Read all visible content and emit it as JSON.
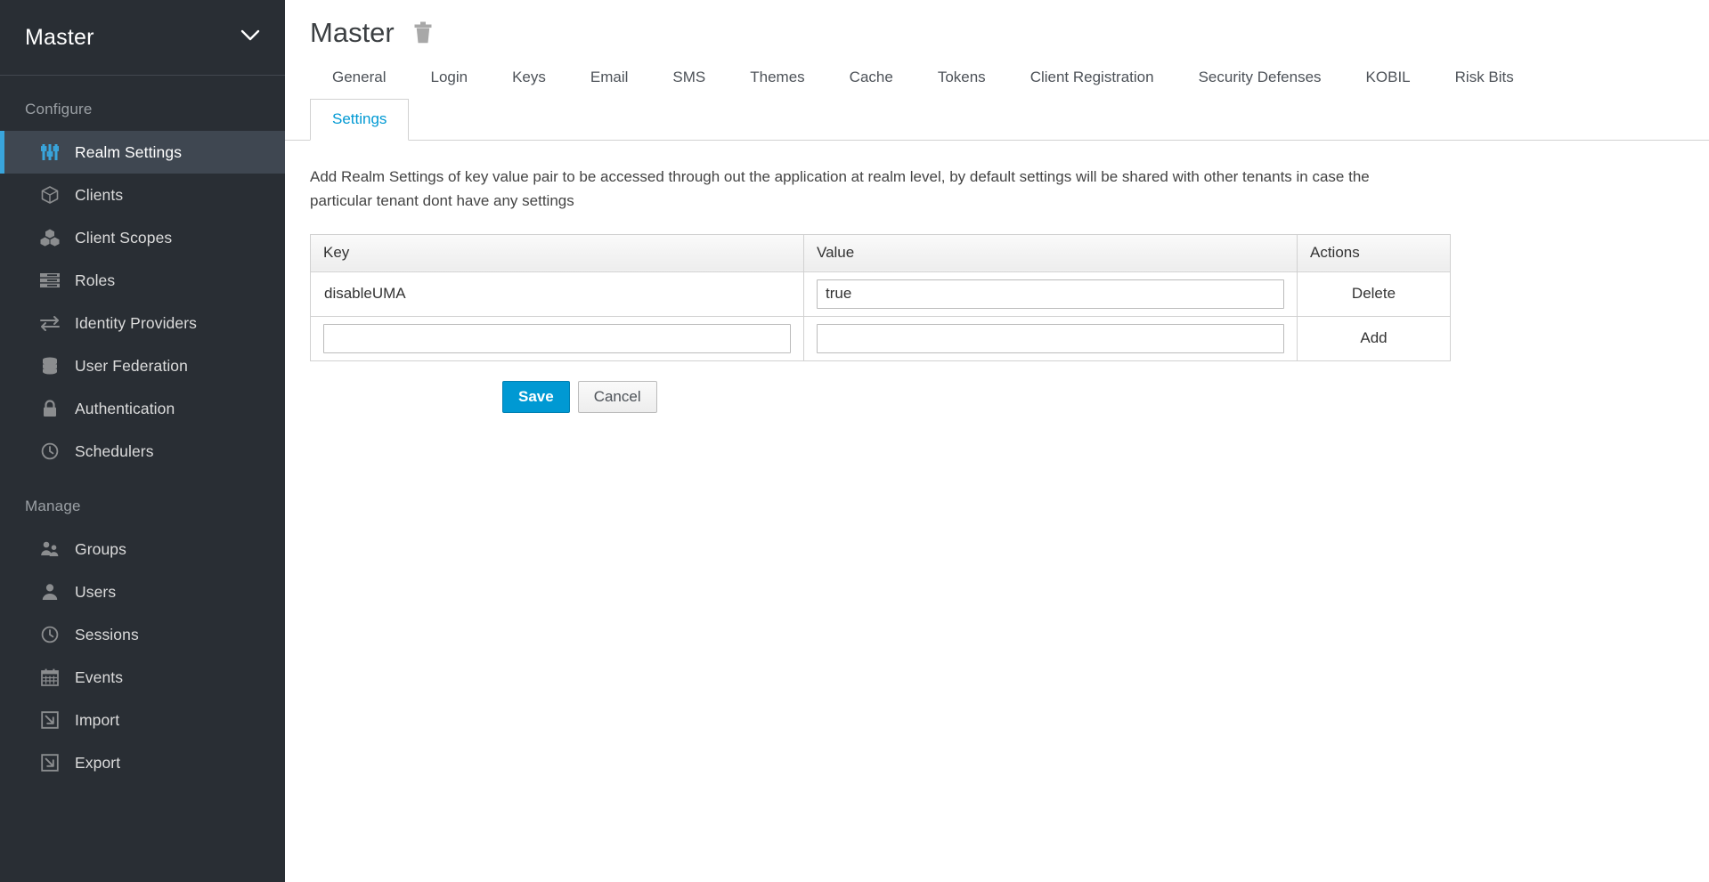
{
  "sidebar": {
    "realm_name": "Master",
    "realm_chevron_icon": "chevron-down-icon",
    "sections": [
      {
        "title": "Configure",
        "items": [
          {
            "label": "Realm Settings",
            "icon": "sliders-icon",
            "active": true
          },
          {
            "label": "Clients",
            "icon": "cube-icon",
            "active": false
          },
          {
            "label": "Client Scopes",
            "icon": "cubes-icon",
            "active": false
          },
          {
            "label": "Roles",
            "icon": "list-rows-icon",
            "active": false
          },
          {
            "label": "Identity Providers",
            "icon": "exchange-arrows-icon",
            "active": false
          },
          {
            "label": "User Federation",
            "icon": "database-icon",
            "active": false
          },
          {
            "label": "Authentication",
            "icon": "lock-icon",
            "active": false
          },
          {
            "label": "Schedulers",
            "icon": "clock-icon",
            "active": false
          }
        ]
      },
      {
        "title": "Manage",
        "items": [
          {
            "label": "Groups",
            "icon": "users-group-icon",
            "active": false
          },
          {
            "label": "Users",
            "icon": "user-icon",
            "active": false
          },
          {
            "label": "Sessions",
            "icon": "clock-icon",
            "active": false
          },
          {
            "label": "Events",
            "icon": "calendar-icon",
            "active": false
          },
          {
            "label": "Import",
            "icon": "import-arrow-icon",
            "active": false
          },
          {
            "label": "Export",
            "icon": "export-arrow-icon",
            "active": false
          }
        ]
      }
    ]
  },
  "header": {
    "title": "Master",
    "delete_icon": "trash-icon"
  },
  "tabs": [
    {
      "label": "General",
      "active": false
    },
    {
      "label": "Login",
      "active": false
    },
    {
      "label": "Keys",
      "active": false
    },
    {
      "label": "Email",
      "active": false
    },
    {
      "label": "SMS",
      "active": false
    },
    {
      "label": "Themes",
      "active": false
    },
    {
      "label": "Cache",
      "active": false
    },
    {
      "label": "Tokens",
      "active": false
    },
    {
      "label": "Client Registration",
      "active": false
    },
    {
      "label": "Security Defenses",
      "active": false
    },
    {
      "label": "KOBIL",
      "active": false
    },
    {
      "label": "Risk Bits",
      "active": false
    }
  ],
  "subtabs": [
    {
      "label": "Settings",
      "active": true
    }
  ],
  "main": {
    "description": "Add Realm Settings of key value pair to be accessed through out the application at realm level, by default settings will be shared with other tenants in case the particular tenant dont have any settings"
  },
  "table": {
    "columns": [
      "Key",
      "Value",
      "Actions"
    ],
    "rows": [
      {
        "key": "disableUMA",
        "key_editable": false,
        "key_placeholder": "",
        "value": "true",
        "value_editable": true,
        "value_placeholder": "",
        "action": "Delete"
      },
      {
        "key": "",
        "key_editable": true,
        "key_placeholder": "",
        "value": "",
        "value_editable": true,
        "value_placeholder": "",
        "action": "Add"
      }
    ]
  },
  "buttons": {
    "save": "Save",
    "cancel": "Cancel"
  },
  "colors": {
    "sidebar_bg": "#292e34",
    "sidebar_active_bg": "#3f4751",
    "accent_blue": "#39a5dc",
    "primary_button": "#0099d3",
    "link_blue": "#0099d3",
    "border": "#d1d1d1"
  }
}
